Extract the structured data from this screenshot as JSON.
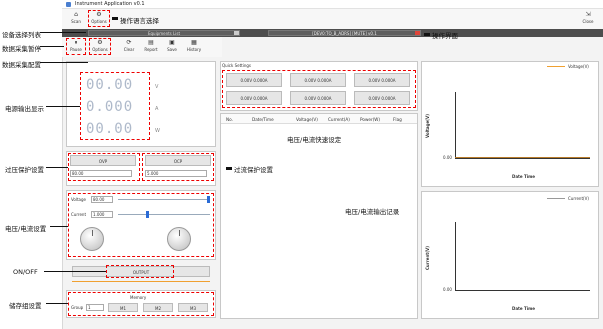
{
  "window": {
    "title": "Instrument Application v0.1",
    "close_label": "×",
    "maximize_label": "□",
    "minimize_label": "—"
  },
  "toolbar": {
    "scan_label": "Scan",
    "options_label": "Options",
    "close_label": "Close"
  },
  "device_bar": {
    "list_label": "Equipments List",
    "device_info": "[DEV0:TO_B_ADRS] [MUTE] v0.1"
  },
  "acq_toolbar": {
    "pause_label": "Pause",
    "options_label": "Options",
    "clear_label": "Clear",
    "report_label": "Report",
    "save_label": "Save",
    "history_label": "History"
  },
  "display": {
    "voltage": "00.00",
    "voltage_unit": "V",
    "current": "0.000",
    "current_unit": "A",
    "power": "00.00",
    "power_unit": "W"
  },
  "ovp": {
    "button_label": "OVP",
    "value": "80.00"
  },
  "ocp": {
    "button_label": "OCP",
    "value": "5.000"
  },
  "settings": {
    "voltage_label": "Voltage",
    "voltage_value": "80.00",
    "current_label": "Current",
    "current_value": "1.000",
    "voltage_slider_pct": 100,
    "current_slider_pct": 32
  },
  "output": {
    "button_label": "OUTPUT"
  },
  "memory": {
    "title": "Memory",
    "group_label": "Group",
    "group_value": "1",
    "m1_label": "M1",
    "m2_label": "M2",
    "m3_label": "M3"
  },
  "quick_settings": {
    "title": "Quick Settings",
    "items": [
      "0.00V 0.000A",
      "0.00V 0.000A",
      "0.00V 0.000A",
      "0.00V 0.000A",
      "0.00V 0.000A",
      "0.00V 0.000A"
    ]
  },
  "log_table": {
    "columns": [
      "No.",
      "Date/Time",
      "Voltage(V)",
      "Current(A)",
      "Power(W)",
      "Flag"
    ]
  },
  "voltage_chart": {
    "legend": "Voltage(V)",
    "ylabel": "Voltage(V)",
    "xlabel": "Date Time",
    "tick": "0.00"
  },
  "current_chart": {
    "legend": "Current(V)",
    "ylabel": "Current(V)",
    "xlabel": "Date Time",
    "tick": "0.00"
  },
  "annotations": {
    "options_select": "操作语言选择",
    "device_list": "设备选择列表",
    "acq_pause": "数据采集暂停",
    "acq_config": "数据采集配置",
    "operation_ui": "操作界面",
    "power_display": "电源输出显示",
    "quick_set": "电压/电流快速设定",
    "ovp": "过压保护设置",
    "ocp": "过流保护设置",
    "vi_setting": "电压/电流设置",
    "vi_log": "电压/电流输出记录",
    "onoff": "ON/OFF",
    "memory": "储存组设置"
  },
  "chart_data": [
    {
      "type": "line",
      "title": "",
      "ylabel": "Voltage(V)",
      "xlabel": "Date Time",
      "series": [
        {
          "name": "Voltage(V)",
          "values": [
            0.0
          ]
        }
      ],
      "ytick": "0.00"
    },
    {
      "type": "line",
      "title": "",
      "ylabel": "Current(V)",
      "xlabel": "Date Time",
      "series": [
        {
          "name": "Current(V)",
          "values": [
            0.0
          ]
        }
      ],
      "ytick": "0.00"
    }
  ]
}
